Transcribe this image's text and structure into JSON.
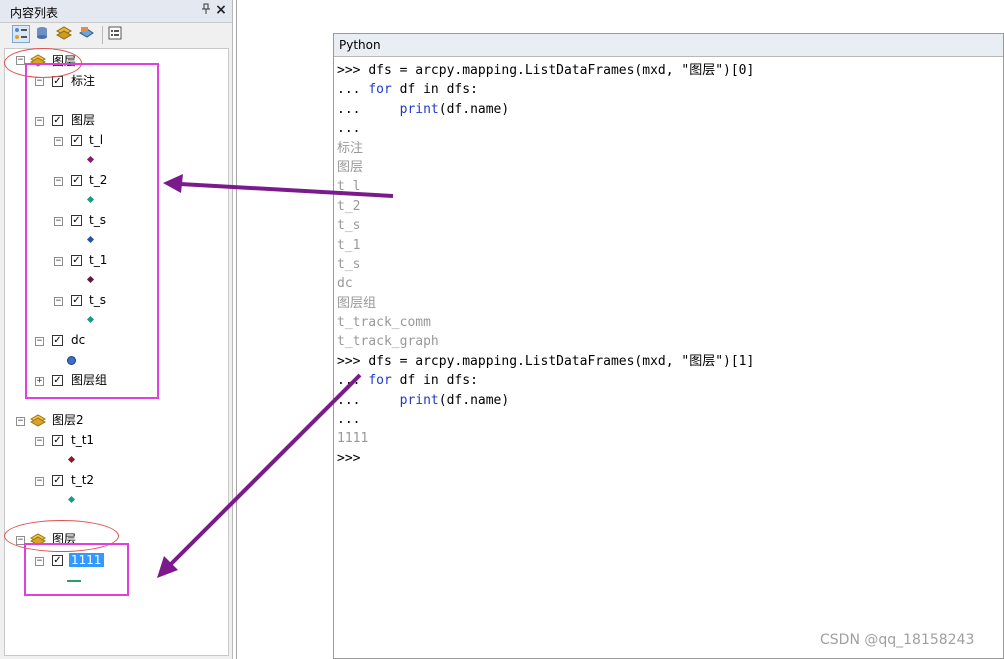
{
  "toc": {
    "title": "内容列表",
    "pin_glyph": "ᵖ",
    "close_glyph": "×",
    "toolbar_icons": [
      "list-by-drawing-order-icon",
      "list-by-source-icon",
      "list-by-visibility-icon",
      "list-by-selection-icon",
      "options-icon"
    ]
  },
  "tree": {
    "df1": {
      "name": "图层",
      "expander": "−"
    },
    "df1_layers": [
      {
        "label": "标注",
        "expander": "−",
        "checked": "✓"
      },
      {
        "label": "图层",
        "expander": "−",
        "checked": "✓"
      },
      {
        "label": "t_l",
        "expander": "−",
        "checked": "✓"
      },
      {
        "label": "t_2",
        "expander": "−",
        "checked": "✓"
      },
      {
        "label": "t_s",
        "expander": "−",
        "checked": "✓"
      },
      {
        "label": "t_1",
        "expander": "−",
        "checked": "✓"
      },
      {
        "label": "t_s",
        "expander": "−",
        "checked": "✓"
      },
      {
        "label": "dc",
        "expander": "−",
        "checked": "✓"
      },
      {
        "label": "图层组",
        "expander": "+",
        "checked": "✓"
      }
    ],
    "df2": {
      "name": "图层2",
      "expander": "−"
    },
    "df2_layers": [
      {
        "label": "t_t1",
        "expander": "−",
        "checked": "✓"
      },
      {
        "label": "t_t2",
        "expander": "−",
        "checked": "✓"
      }
    ],
    "df3": {
      "name": "图层",
      "expander": "−"
    },
    "df3_layers": [
      {
        "label": "1111",
        "expander": "−",
        "checked": "✓"
      }
    ]
  },
  "python": {
    "title": "Python",
    "lines": [
      {
        "type": "cmd",
        "prompt": ">>> ",
        "pre": "dfs = arcpy.mapping.ListDataFrames(mxd, \"图层\")[0]",
        "kw": "",
        "post": ""
      },
      {
        "type": "cmd",
        "prompt": "... ",
        "pre": "",
        "kw": "for",
        "post": " df in dfs:"
      },
      {
        "type": "cmd",
        "prompt": "...     ",
        "pre": "",
        "kw": "print",
        "post": "(df.name)"
      },
      {
        "type": "cmd",
        "prompt": "...",
        "pre": "",
        "kw": "",
        "post": ""
      },
      {
        "type": "out",
        "text": "标注"
      },
      {
        "type": "out",
        "text": "图层"
      },
      {
        "type": "out",
        "text": "t_l"
      },
      {
        "type": "out",
        "text": "t_2"
      },
      {
        "type": "out",
        "text": "t_s"
      },
      {
        "type": "out",
        "text": "t_1"
      },
      {
        "type": "out",
        "text": "t_s"
      },
      {
        "type": "out",
        "text": "dc"
      },
      {
        "type": "out",
        "text": "图层组"
      },
      {
        "type": "out",
        "text": "t_track_comm"
      },
      {
        "type": "out",
        "text": "t_track_graph"
      },
      {
        "type": "cmd",
        "prompt": ">>> ",
        "pre": "dfs = arcpy.mapping.ListDataFrames(mxd, \"图层\")[1]",
        "kw": "",
        "post": ""
      },
      {
        "type": "cmd",
        "prompt": "... ",
        "pre": "",
        "kw": "for",
        "post": " df in dfs:"
      },
      {
        "type": "cmd",
        "prompt": "...     ",
        "pre": "",
        "kw": "print",
        "post": "(df.name)"
      },
      {
        "type": "cmd",
        "prompt": "...",
        "pre": "",
        "kw": "",
        "post": ""
      },
      {
        "type": "out",
        "text": "1111"
      },
      {
        "type": "cmd",
        "prompt": ">>>",
        "pre": "",
        "kw": "",
        "post": ""
      }
    ]
  },
  "colors": {
    "annotation_rect": "#e040e0",
    "annotation_ellipse": "#e05050",
    "arrow": "#7b1a8c",
    "keyword": "#1e3ac8",
    "output_text": "#999999",
    "selection": "#3399ff"
  },
  "watermark": "CSDN @qq_18158243"
}
